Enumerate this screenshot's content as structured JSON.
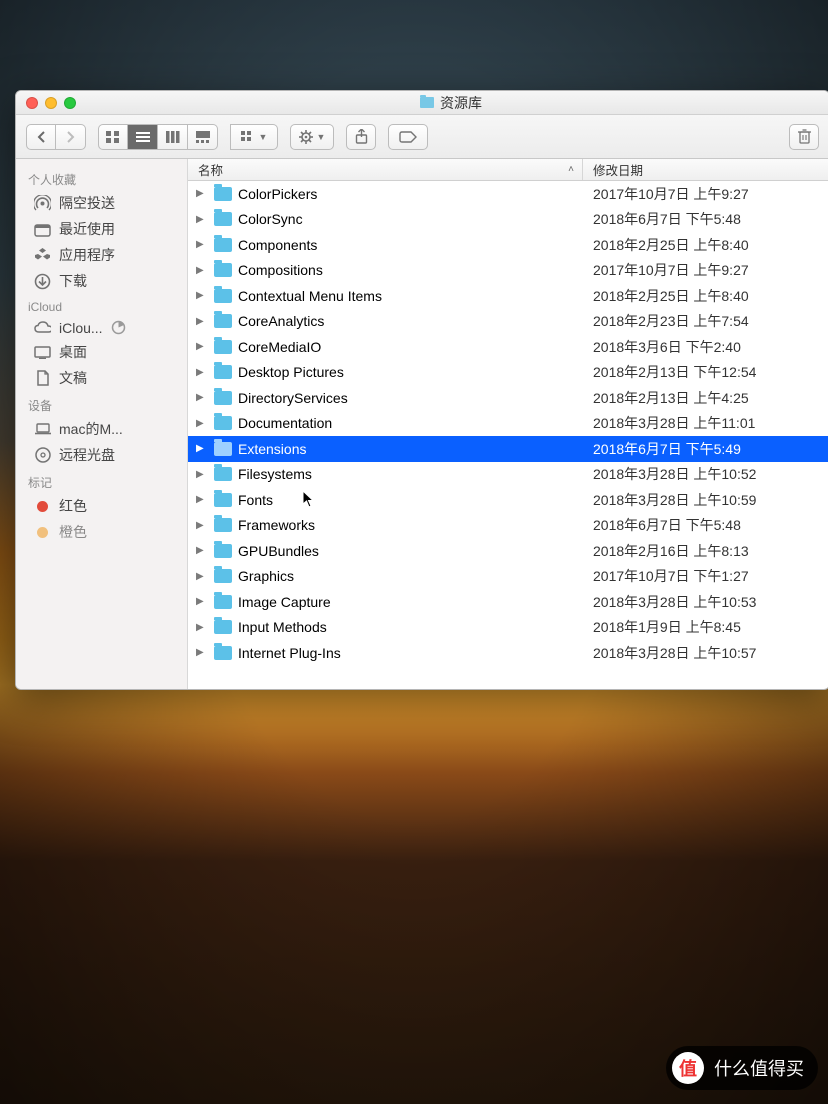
{
  "window": {
    "title": "资源库"
  },
  "columns": {
    "name": "名称",
    "date": "修改日期"
  },
  "sidebar": {
    "sections": [
      {
        "heading": "个人收藏",
        "items": [
          {
            "icon": "airdrop",
            "label": "隔空投送"
          },
          {
            "icon": "recent",
            "label": "最近使用"
          },
          {
            "icon": "apps",
            "label": "应用程序"
          },
          {
            "icon": "downloads",
            "label": "下载"
          }
        ]
      },
      {
        "heading": "iCloud",
        "items": [
          {
            "icon": "icloud",
            "label": "iClou...",
            "progress": true
          },
          {
            "icon": "desktop",
            "label": "桌面"
          },
          {
            "icon": "documents",
            "label": "文稿"
          }
        ]
      },
      {
        "heading": "设备",
        "items": [
          {
            "icon": "laptop",
            "label": "mac的M..."
          },
          {
            "icon": "disc",
            "label": "远程光盘"
          }
        ]
      },
      {
        "heading": "标记",
        "items": [
          {
            "icon": "tag",
            "color": "#e24b3b",
            "label": "红色"
          },
          {
            "icon": "tag",
            "color": "#f0a030",
            "label": "橙色",
            "cutoff": true
          }
        ]
      }
    ]
  },
  "files": [
    {
      "name": "ColorPickers",
      "date": "2017年10月7日 上午9:27"
    },
    {
      "name": "ColorSync",
      "date": "2018年6月7日 下午5:48"
    },
    {
      "name": "Components",
      "date": "2018年2月25日 上午8:40"
    },
    {
      "name": "Compositions",
      "date": "2017年10月7日 上午9:27"
    },
    {
      "name": "Contextual Menu Items",
      "date": "2018年2月25日 上午8:40"
    },
    {
      "name": "CoreAnalytics",
      "date": "2018年2月23日 上午7:54"
    },
    {
      "name": "CoreMediaIO",
      "date": "2018年3月6日 下午2:40"
    },
    {
      "name": "Desktop Pictures",
      "date": "2018年2月13日 下午12:54"
    },
    {
      "name": "DirectoryServices",
      "date": "2018年2月13日 上午4:25"
    },
    {
      "name": "Documentation",
      "date": "2018年3月28日 上午11:01"
    },
    {
      "name": "Extensions",
      "date": "2018年6月7日 下午5:49",
      "selected": true
    },
    {
      "name": "Filesystems",
      "date": "2018年3月28日 上午10:52"
    },
    {
      "name": "Fonts",
      "date": "2018年3月28日 上午10:59"
    },
    {
      "name": "Frameworks",
      "date": "2018年6月7日 下午5:48"
    },
    {
      "name": "GPUBundles",
      "date": "2018年2月16日 上午8:13"
    },
    {
      "name": "Graphics",
      "date": "2017年10月7日 下午1:27"
    },
    {
      "name": "Image Capture",
      "date": "2018年3月28日 上午10:53"
    },
    {
      "name": "Input Methods",
      "date": "2018年1月9日 上午8:45"
    },
    {
      "name": "Internet Plug-Ins",
      "date": "2018年3月28日 上午10:57"
    }
  ],
  "watermark": {
    "badge": "值",
    "text": "什么值得买"
  }
}
